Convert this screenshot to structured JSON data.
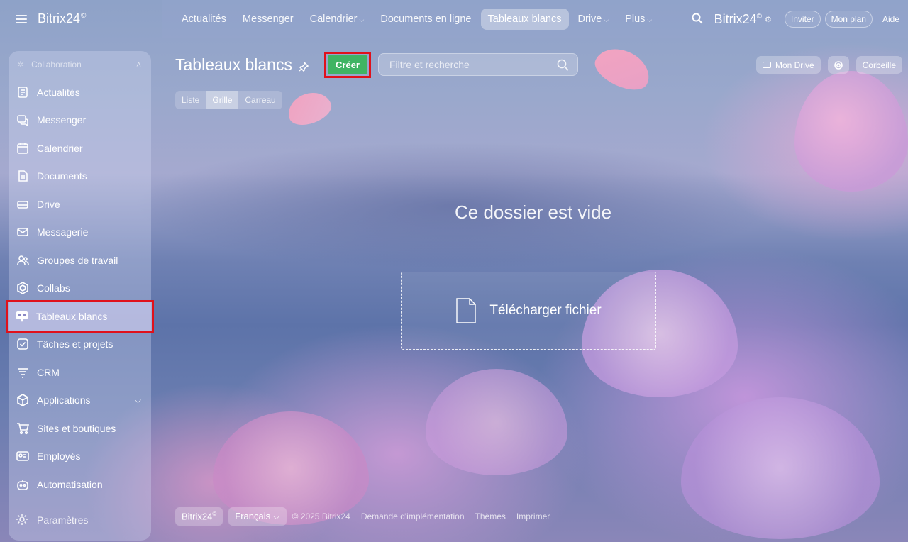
{
  "app": {
    "logo": "Bitrix24",
    "logo_mark": "©"
  },
  "topnav": {
    "items": [
      {
        "label": "Actualités"
      },
      {
        "label": "Messenger"
      },
      {
        "label": "Calendrier"
      },
      {
        "label": "Documents en ligne"
      },
      {
        "label": "Tableaux blancs"
      },
      {
        "label": "Drive"
      },
      {
        "label": "Plus"
      }
    ],
    "brand": "Bitrix24",
    "brand_mark": "©",
    "invite": "Inviter",
    "plan": "Mon plan",
    "help": "Aide"
  },
  "sidebar": {
    "section": "Collaboration",
    "items": [
      {
        "label": "Actualités"
      },
      {
        "label": "Messenger"
      },
      {
        "label": "Calendrier"
      },
      {
        "label": "Documents"
      },
      {
        "label": "Drive"
      },
      {
        "label": "Messagerie"
      },
      {
        "label": "Groupes de travail"
      },
      {
        "label": "Collabs"
      },
      {
        "label": "Tableaux blancs"
      },
      {
        "label": "Tâches et projets"
      },
      {
        "label": "CRM"
      },
      {
        "label": "Applications"
      },
      {
        "label": "Sites et boutiques"
      },
      {
        "label": "Employés"
      },
      {
        "label": "Automatisation"
      }
    ],
    "settings": "Paramètres"
  },
  "main": {
    "title": "Tableaux blancs",
    "create": "Créer",
    "filter_placeholder": "Filtre et recherche",
    "my_drive": "Mon Drive",
    "trash": "Corbeille",
    "views": [
      "Liste",
      "Grille",
      "Carreau"
    ],
    "empty": "Ce dossier est vide",
    "upload": "Télécharger fichier"
  },
  "footer": {
    "brand": "Bitrix24",
    "brand_mark": "©",
    "language": "Français",
    "copyright": "© 2025 Bitrix24",
    "links": [
      "Demande d'implémentation",
      "Thèmes",
      "Imprimer"
    ]
  },
  "colors": {
    "accent_green": "#3fb463",
    "highlight_red": "#e0111b"
  }
}
